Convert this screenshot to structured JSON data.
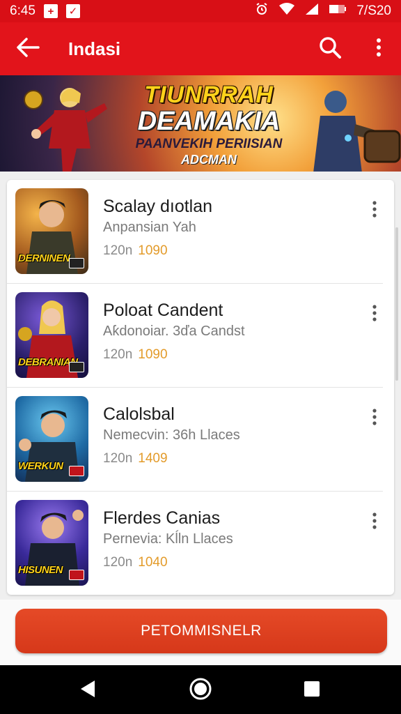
{
  "status_bar": {
    "time": "6:45",
    "right_text": "7/S20"
  },
  "app_bar": {
    "title": "Indasi"
  },
  "banner": {
    "line1": "TIUNRRAH",
    "line2": "DEAMAKIA",
    "line3": "PAANVEKIH PERIISIAN",
    "line4": "ADCMAN"
  },
  "items": [
    {
      "title": "Scalay dıotlan",
      "subtitle": "Anpansian Yah",
      "meta": "120n",
      "accent": "1090",
      "thumb_label": "DERNINEN"
    },
    {
      "title": "Poloat Candent",
      "subtitle": "Aƙdonoiar. 3ďa Candst",
      "meta": "120n",
      "accent": "1090",
      "thumb_label": "DEBRANIAN"
    },
    {
      "title": "Calolsbal",
      "subtitle": "Nemecvin: 36h Llaces",
      "meta": "120n",
      "accent": "1409",
      "thumb_label": "WERKUN"
    },
    {
      "title": "Flerdes Canias",
      "subtitle": "Pernevia: Kĺln Llaces",
      "meta": "120n",
      "accent": "1040",
      "thumb_label": "HISUNEN"
    }
  ],
  "cta": {
    "label": "PETOMMISNELR"
  },
  "colors": {
    "primary": "#e2141b",
    "status": "#d80f16",
    "accent": "#e39b2a",
    "cta": "#d6381a"
  }
}
